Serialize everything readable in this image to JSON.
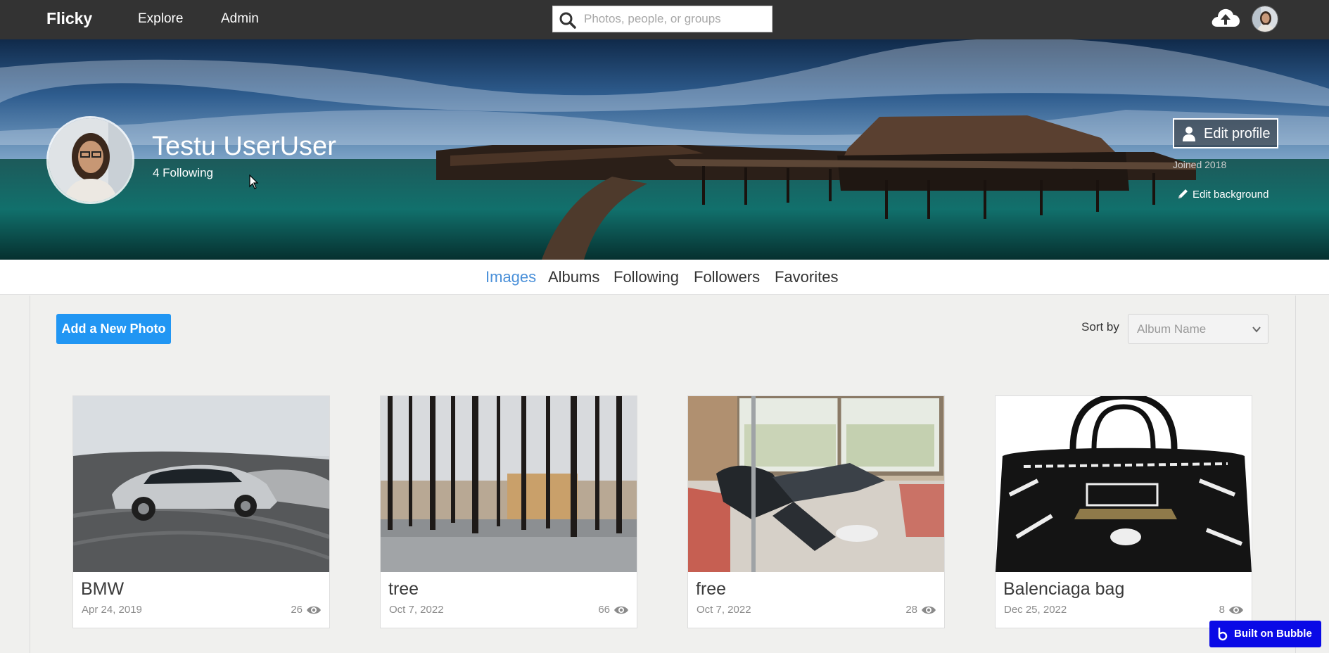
{
  "nav": {
    "brand": "Flicky",
    "links": [
      "Explore",
      "Admin"
    ],
    "search_placeholder": "Photos, people, or groups",
    "search_icon": "search-icon",
    "upload_icon": "cloud-upload-icon"
  },
  "profile": {
    "name": "Testu UserUser",
    "following": "4 Following",
    "edit_profile": "Edit profile",
    "joined": "Joined 2018",
    "edit_background": "Edit background"
  },
  "tabs": [
    "Images",
    "Albums",
    "Following",
    "Followers",
    "Favorites"
  ],
  "active_tab": "Images",
  "toolbar": {
    "add_photo": "Add a New Photo",
    "sort_label": "Sort by",
    "sort_value": "Album Name"
  },
  "photos": [
    {
      "title": "BMW",
      "date": "Apr 24, 2019",
      "views": "26"
    },
    {
      "title": "tree",
      "date": "Oct 7, 2022",
      "views": "66"
    },
    {
      "title": "free",
      "date": "Oct 7, 2022",
      "views": "28"
    },
    {
      "title": "Balenciaga bag",
      "date": "Dec 25, 2022",
      "views": "8"
    }
  ],
  "badge": {
    "label": "Built on Bubble"
  },
  "colors": {
    "topbar": "#333333",
    "accent_blue": "#2196f3",
    "active_tab": "#4a90d9",
    "bubble": "#0a0ae6"
  }
}
